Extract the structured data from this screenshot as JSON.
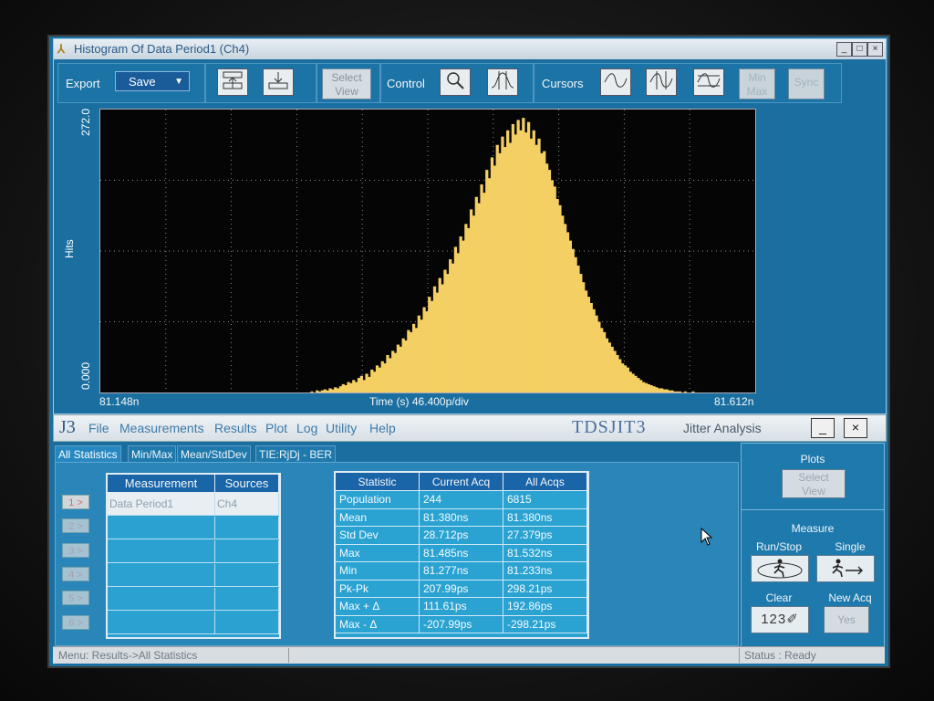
{
  "histogram_window": {
    "title": "Histogram Of Data Period1 (Ch4)",
    "controls": {
      "minimize": "_",
      "maximize": "□",
      "close": "×"
    }
  },
  "toolbar": {
    "export_label": "Export",
    "save_label": "Save",
    "select_view_line1": "Select",
    "select_view_line2": "View",
    "control_label": "Control",
    "cursors_label": "Cursors",
    "minmax_line1": "Min",
    "minmax_line2": "Max",
    "sync_label": "Sync"
  },
  "chart_data": {
    "type": "bar",
    "ylabel": "Hits",
    "y_top_label": "272.0",
    "y_bottom_label": "0.000",
    "ylim": [
      0,
      272
    ],
    "x_left_label": "81.148n",
    "x_right_label": "81.612n",
    "x_center_label": "Time (s)  46.400p/div",
    "xlim_ns": [
      81.148,
      81.612
    ],
    "grid": true,
    "bar_color": "#f4cf63",
    "x_start_ns": 81.295,
    "bin_width_ns": 0.00185,
    "values": [
      0,
      1,
      0,
      2,
      1,
      2,
      3,
      2,
      4,
      3,
      5,
      4,
      6,
      8,
      7,
      10,
      9,
      12,
      10,
      14,
      16,
      12,
      18,
      15,
      22,
      20,
      26,
      24,
      30,
      28,
      36,
      33,
      40,
      38,
      46,
      44,
      52,
      50,
      60,
      58,
      66,
      62,
      74,
      70,
      82,
      78,
      92,
      88,
      102,
      96,
      110,
      104,
      118,
      114,
      128,
      124,
      140,
      134,
      150,
      146,
      162,
      158,
      176,
      170,
      188,
      182,
      200,
      192,
      214,
      206,
      226,
      218,
      238,
      230,
      246,
      236,
      252,
      240,
      258,
      248,
      262,
      252,
      264,
      250,
      260,
      244,
      252,
      238,
      244,
      230,
      232,
      220,
      214,
      204,
      198,
      186,
      180,
      170,
      162,
      154,
      146,
      138,
      130,
      122,
      114,
      106,
      98,
      92,
      86,
      80,
      74,
      68,
      62,
      58,
      52,
      48,
      44,
      40,
      36,
      32,
      28,
      26,
      24,
      20,
      18,
      16,
      14,
      12,
      10,
      9,
      8,
      7,
      6,
      5,
      4,
      4,
      3,
      3,
      2,
      2,
      1,
      1,
      1,
      0,
      1,
      0,
      0,
      1,
      0,
      0
    ]
  },
  "app": {
    "logo": "J3",
    "menu": [
      "File",
      "Measurements",
      "Results",
      "Plot",
      "Log",
      "Utility",
      "Help"
    ],
    "brand": "TDSJIT3",
    "subtitle": "Jitter Analysis",
    "min_btn": "_",
    "close_btn": "×",
    "tabs": [
      "All Statistics",
      "Min/Max",
      "Mean/StdDev",
      "TIE:RjDj - BER"
    ],
    "row_buttons": [
      "1 >",
      "2 >",
      "3 >",
      "4 >",
      "5 >",
      "6 >"
    ],
    "measurement_table": {
      "headers": [
        "Measurement",
        "Sources"
      ],
      "rows": [
        [
          "Data Period1",
          "Ch4"
        ],
        [
          "",
          ""
        ],
        [
          "",
          ""
        ],
        [
          "",
          ""
        ],
        [
          "",
          ""
        ],
        [
          "",
          ""
        ]
      ]
    },
    "stats_table": {
      "headers": [
        "Statistic",
        "Current Acq",
        "All Acqs"
      ],
      "rows": [
        [
          "Population",
          "244",
          "6815"
        ],
        [
          "Mean",
          "81.380ns",
          "81.380ns"
        ],
        [
          "Std Dev",
          "28.712ps",
          "27.379ps"
        ],
        [
          "Max",
          "81.485ns",
          "81.532ns"
        ],
        [
          "Min",
          "81.277ns",
          "81.233ns"
        ],
        [
          "Pk-Pk",
          "207.99ps",
          "298.21ps"
        ],
        [
          "Max + Δ",
          "111.61ps",
          "192.86ps"
        ],
        [
          "Max - Δ",
          "-207.99ps",
          "-298.21ps"
        ]
      ]
    },
    "plots_panel": {
      "title": "Plots",
      "select_line1": "Select",
      "select_line2": "View"
    },
    "measure_panel": {
      "title": "Measure",
      "run_stop": "Run/Stop",
      "single": "Single",
      "clear": "Clear",
      "clear_icon_text": "123",
      "new_acq": "New Acq",
      "yes": "Yes"
    },
    "status": {
      "left": "Menu: Results->All Statistics",
      "right": "Status : Ready"
    }
  }
}
